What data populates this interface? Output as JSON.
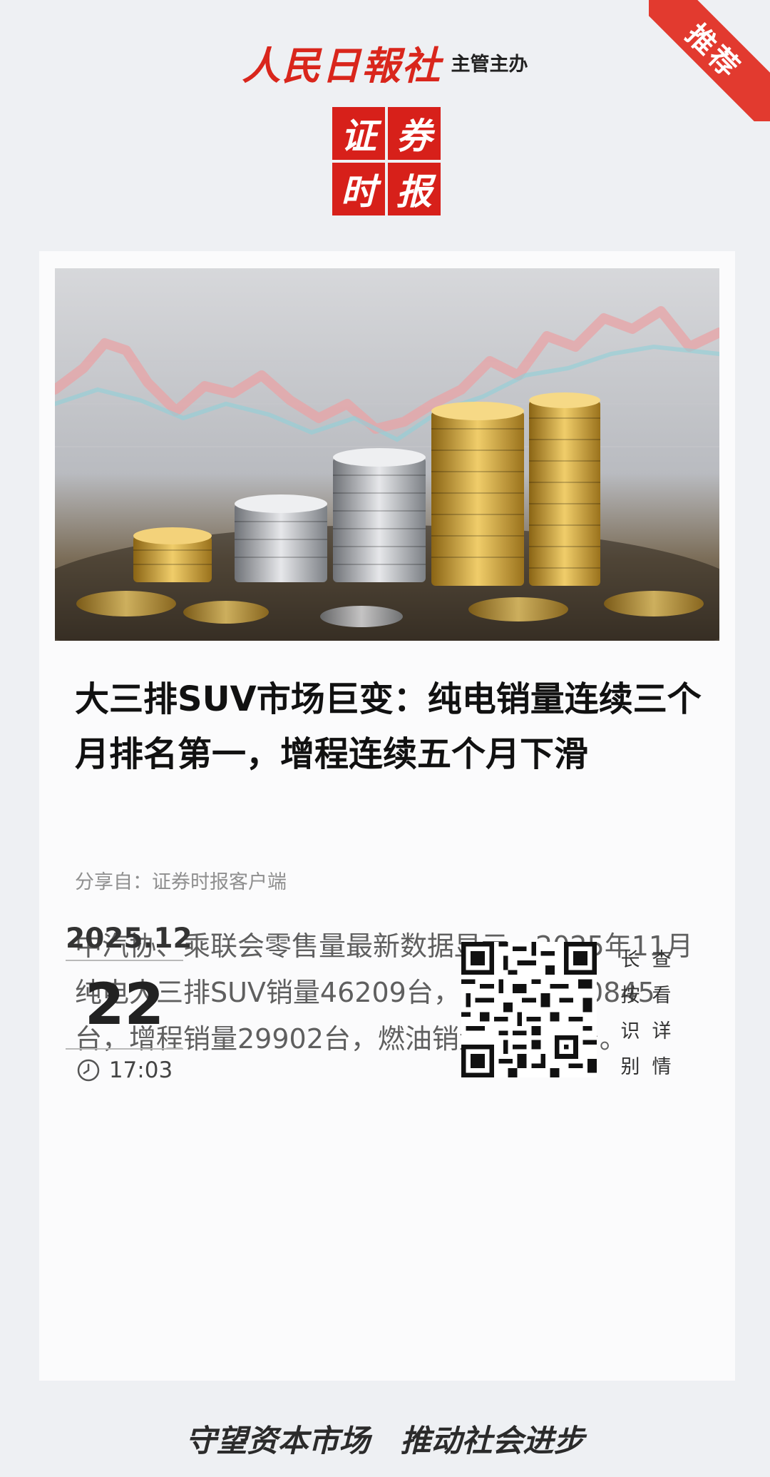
{
  "ribbon": {
    "label": "推荐"
  },
  "masthead": {
    "brand": "人民日報社",
    "sponsor": "主管主办"
  },
  "logo": {
    "chars": [
      "证",
      "券",
      "时",
      "报"
    ]
  },
  "article": {
    "headline": "大三排SUV市场巨变：纯电销量连续三个月排名第一，增程连续五个月下滑",
    "share_from": "分享自：证券时报客户端",
    "summary": "中汽协、乘联会零售量最新数据显示，2025年11月纯电大三排SUV销量46209台，插混销量40845台，增程销量29902台，燃油销量22398台。"
  },
  "date": {
    "year_month": "2025.12",
    "day": "22",
    "time": "17:03"
  },
  "qr": {
    "hint_chars": [
      "长",
      "查",
      "按",
      "看",
      "识",
      "详",
      "别",
      "情"
    ]
  },
  "footer": {
    "slogan": "守望资本市场　推动社会进步"
  },
  "colors": {
    "brand_red": "#d7201a",
    "ribbon_red": "#e23a2f",
    "background": "#eef0f3"
  },
  "icons": [
    "clock-icon",
    "qr-code"
  ]
}
